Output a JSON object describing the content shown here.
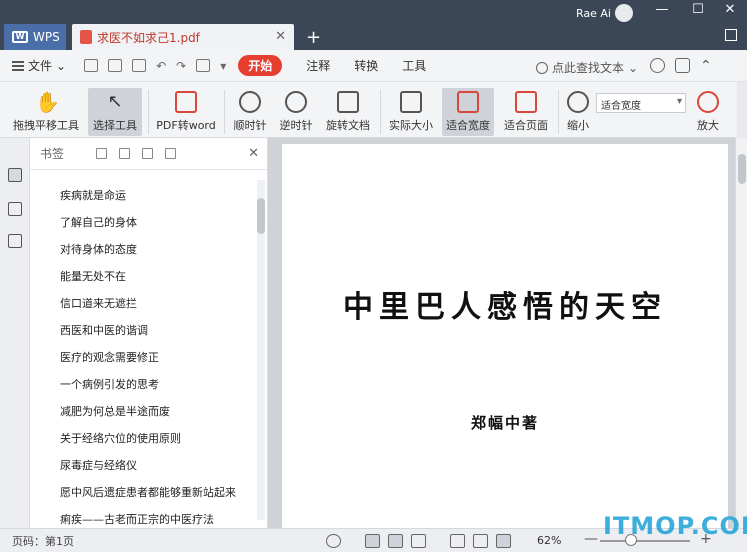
{
  "titlebar": {
    "app_tab": "WPS",
    "doc_tab": "求医不如求己1.pdf",
    "user": "Rae Ai"
  },
  "menubar": {
    "file": "文件",
    "start": "开始",
    "items": [
      "注释",
      "转换",
      "工具"
    ],
    "search": "点此查找文本"
  },
  "ribbon": {
    "tools": [
      {
        "label": "拖拽平移工具",
        "icon": "hand-icon"
      },
      {
        "label": "选择工具",
        "icon": "cursor-icon",
        "active": true
      },
      {
        "label": "PDF转word",
        "icon": "pdf-to-word-icon"
      },
      {
        "label": "顺时针",
        "icon": "rotate-clockwise-icon"
      },
      {
        "label": "逆时针",
        "icon": "rotate-counterclockwise-icon"
      },
      {
        "label": "旋转文档",
        "icon": "rotate-document-icon"
      },
      {
        "label": "实际大小",
        "icon": "actual-size-icon"
      },
      {
        "label": "适合宽度",
        "icon": "fit-width-icon",
        "active": true
      },
      {
        "label": "适合页面",
        "icon": "fit-page-icon"
      },
      {
        "label": "缩小",
        "icon": "zoom-out-icon"
      },
      {
        "label": "放大",
        "icon": "zoom-in-icon"
      }
    ],
    "zoom_mode": "适合宽度"
  },
  "bookmarks": {
    "title": "书签",
    "items": [
      "疾病就是命运",
      "了解自己的身体",
      "对待身体的态度",
      "能量无处不在",
      "信口道来无遮拦",
      "西医和中医的谐调",
      "医疗的观念需要修正",
      "一个病例引发的思考",
      "减肥为何总是半途而废",
      "关于经络穴位的使用原则",
      "尿毒症与经络仪",
      "愿中风后遗症患者都能够重新站起来",
      "痢疾——古老而正宗的中医疗法"
    ]
  },
  "document": {
    "title": "中里巴人感悟的天空",
    "author": "郑幅中著"
  },
  "statusbar": {
    "page": "页码：第1页",
    "zoom": "62%",
    "zoom_level": 0.62
  },
  "watermark": "ITMOP.COM",
  "colors": {
    "titlebar": "#3b4756",
    "accent_red": "#e63e2f",
    "wps_blue": "#4a6ea8"
  }
}
